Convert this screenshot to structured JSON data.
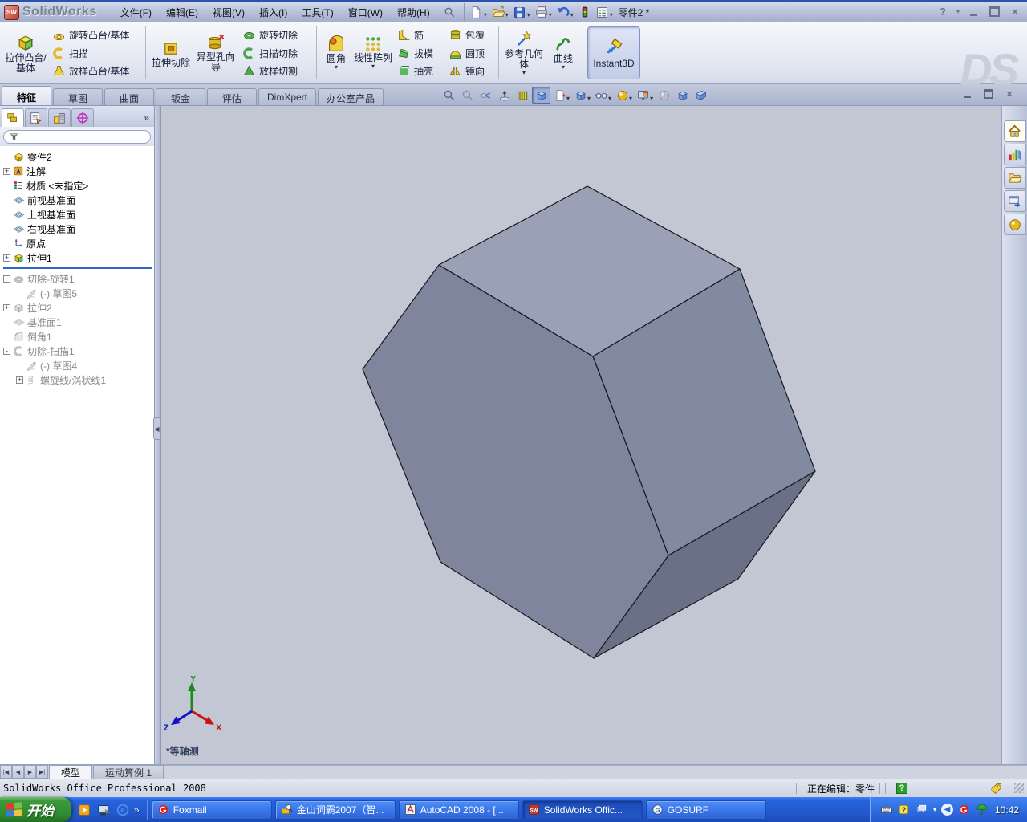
{
  "window": {
    "app_name": "SolidWorks",
    "logo_text": "SW",
    "doc_title": "零件2 *"
  },
  "glyphs": {
    "minimize": "−",
    "close": "×",
    "dropdown": "▾",
    "overflow": "»",
    "question": "?",
    "nav_first": "|◀",
    "nav_prev": "◀",
    "nav_next": "▶",
    "nav_last": "▶|"
  },
  "menubar": {
    "items": [
      {
        "label": "文件(F)"
      },
      {
        "label": "编辑(E)"
      },
      {
        "label": "视图(V)"
      },
      {
        "label": "插入(I)"
      },
      {
        "label": "工具(T)"
      },
      {
        "label": "窗口(W)"
      },
      {
        "label": "帮助(H)"
      }
    ]
  },
  "commandmanager": {
    "extrude_boss": "拉伸凸台/基体",
    "revolve_boss": "旋转凸台/基体",
    "sweep": "扫描",
    "loft_boss": "放样凸台/基体",
    "extrude_cut": "拉伸切除",
    "hole_wizard": "异型孔向导",
    "revolve_cut": "旋转切除",
    "sweep_cut": "扫描切除",
    "loft_cut": "放样切割",
    "fillet": "圆角",
    "linear_pattern": "线性阵列",
    "rib": "筋",
    "draft": "拔模",
    "shell": "抽壳",
    "wrap": "包覆",
    "dome": "圆顶",
    "mirror": "镜向",
    "ref_geometry": "参考几何体",
    "curves": "曲线",
    "instant3d": "Instant3D"
  },
  "feature_tabs": {
    "items": [
      {
        "label": "特征"
      },
      {
        "label": "草图"
      },
      {
        "label": "曲面"
      },
      {
        "label": "钣金"
      },
      {
        "label": "评估"
      },
      {
        "label": "DimXpert"
      },
      {
        "label": "办公室产品"
      }
    ],
    "active": "特征"
  },
  "tree": {
    "root": "零件2",
    "items": [
      {
        "label": "注解",
        "expand": "+"
      },
      {
        "label": "材质 <未指定>"
      },
      {
        "label": "前视基准面"
      },
      {
        "label": "上视基准面"
      },
      {
        "label": "右视基准面"
      },
      {
        "label": "原点"
      },
      {
        "label": "拉伸1",
        "expand": "+"
      },
      {
        "label": "切除-旋转1",
        "expand": "-"
      },
      {
        "label": "(-) 草图5"
      },
      {
        "label": "拉伸2",
        "expand": "+"
      },
      {
        "label": "基准面1"
      },
      {
        "label": "倒角1"
      },
      {
        "label": "切除-扫描1",
        "expand": "-"
      },
      {
        "label": "(-) 草图4"
      },
      {
        "label": "螺旋线/涡状线1",
        "expand": "+"
      }
    ]
  },
  "viewport": {
    "view_label": "*等轴测",
    "axis_x": "X",
    "axis_y": "Y",
    "axis_z": "Z"
  },
  "solid": {
    "faces": {
      "top": "#9aa1b6",
      "front": "#7e859c",
      "right": "#828aa1",
      "bottom": "#6a7187"
    },
    "edge_color": "#17171c",
    "background": "#c3c7d3"
  },
  "model_tabs": {
    "items": [
      {
        "label": "模型"
      },
      {
        "label": "运动算例 1"
      }
    ],
    "active": "模型"
  },
  "statusbar": {
    "product": "SolidWorks Office Professional 2008",
    "editing": "正在编辑：零件"
  },
  "taskbar": {
    "start_label": "开始",
    "tasks": [
      {
        "label": "Foxmail"
      },
      {
        "label": "金山词霸2007（智..."
      },
      {
        "label": "AutoCAD 2008 - [..."
      },
      {
        "label": "SolidWorks Offic..."
      },
      {
        "label": "GOSURF"
      }
    ],
    "clock": "10:42"
  }
}
